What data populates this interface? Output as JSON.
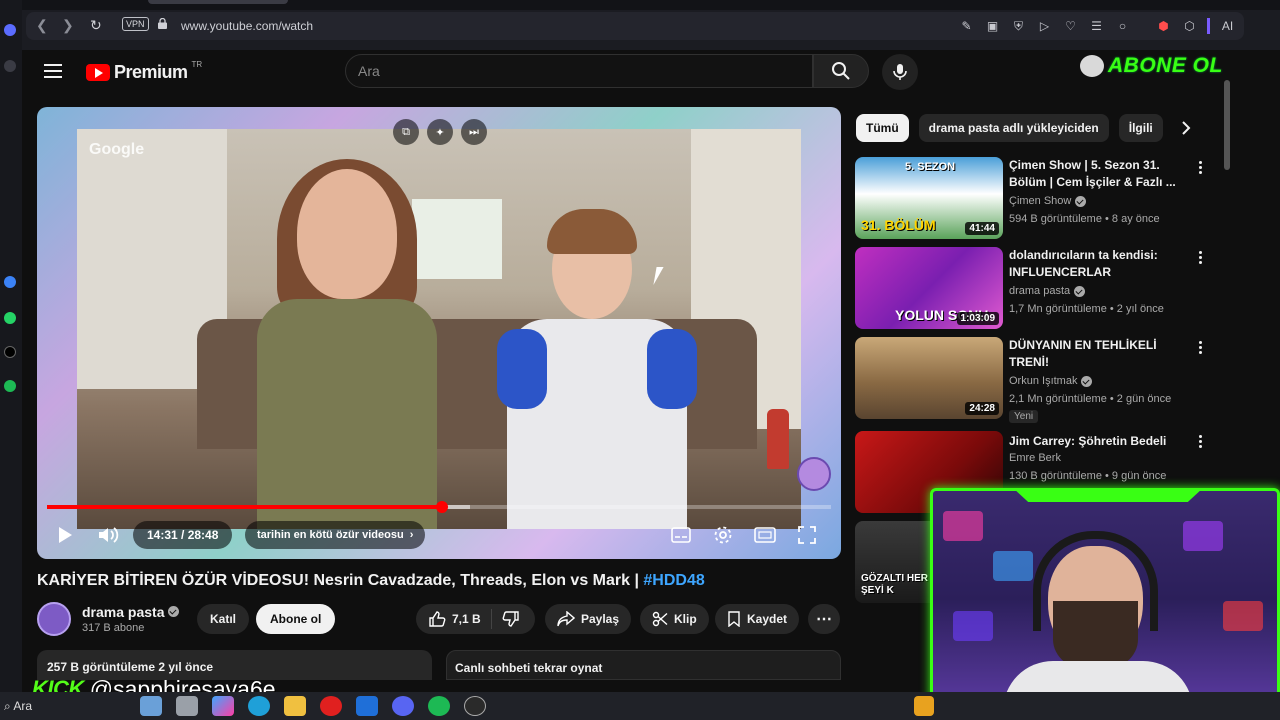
{
  "browser": {
    "vpn_label": "VPN",
    "url": "www.youtube.com/watch",
    "ai_label": "AI",
    "notification_count": "2"
  },
  "header": {
    "logo_text": "Premium",
    "region": "TR",
    "search_placeholder": "Ara",
    "overlay_banner": "ABONE OL"
  },
  "player": {
    "watermark": "Google",
    "current_time": "14:31",
    "duration": "28:48",
    "time_display": "14:31 / 28:48",
    "chapter": "tarihin en kötü özür videosu",
    "progress_fraction": 0.504,
    "buffer_fraction": 0.54
  },
  "video": {
    "title_main": "KARİYER BİTİREN ÖZÜR VİDEOSU! Nesrin Cavadzade, Threads, Elon vs Mark | ",
    "title_tag": "#HDD48",
    "channel_name": "drama pasta",
    "subscribers": "317 B abone",
    "join_label": "Katıl",
    "subscribe_label": "Abone ol",
    "likes": "7,1 B",
    "share_label": "Paylaş",
    "clip_label": "Klip",
    "save_label": "Kaydet",
    "views_date": "257 B görüntüleme  2 yıl önce",
    "chat_replay": "Canlı sohbeti tekrar oynat"
  },
  "sidebar": {
    "chips": [
      "Tümü",
      "drama pasta adlı yükleyiciden",
      "İlgili"
    ],
    "recommendations": [
      {
        "title": "Çimen Show | 5. Sezon 31. Bölüm | Cem İşçiler & Fazlı ...",
        "channel": "Çimen Show",
        "meta": "594 B görüntüleme • 8 ay önce",
        "duration": "41:44",
        "thumb_caption": "31. BÖLÜM",
        "thumb_top": "5. SEZON"
      },
      {
        "title": "dolandırıcıların ta kendisi: INFLUENCERLAR",
        "channel": "drama pasta",
        "meta": "1,7 Mn görüntüleme • 2 yıl önce",
        "duration": "1:03:09",
        "thumb_caption": "YOLUN SONU"
      },
      {
        "title": "DÜNYANIN EN TEHLİKELİ TRENİ!",
        "channel": "Orkun Işıtmak",
        "meta": "2,1 Mn görüntüleme • 2 gün önce",
        "duration": "24:28",
        "badge": "Yeni"
      },
      {
        "title": "Jim Carrey: Şöhretin Bedeli",
        "channel": "Emre Berk",
        "meta": "130 B görüntüleme • 9 gün önce"
      },
      {
        "thumb_caption": "GÖZALTI HER ŞEYİ K"
      }
    ]
  },
  "overlay": {
    "kick_logo": "KICK",
    "kick_handle": "@sapphiresava6e"
  },
  "taskbar": {
    "search_label": "Ara"
  },
  "colors": {
    "yt_red": "#ff0000",
    "link_blue": "#3ea6ff",
    "neon_green": "#39ff14",
    "kick_green": "#53fc18"
  }
}
